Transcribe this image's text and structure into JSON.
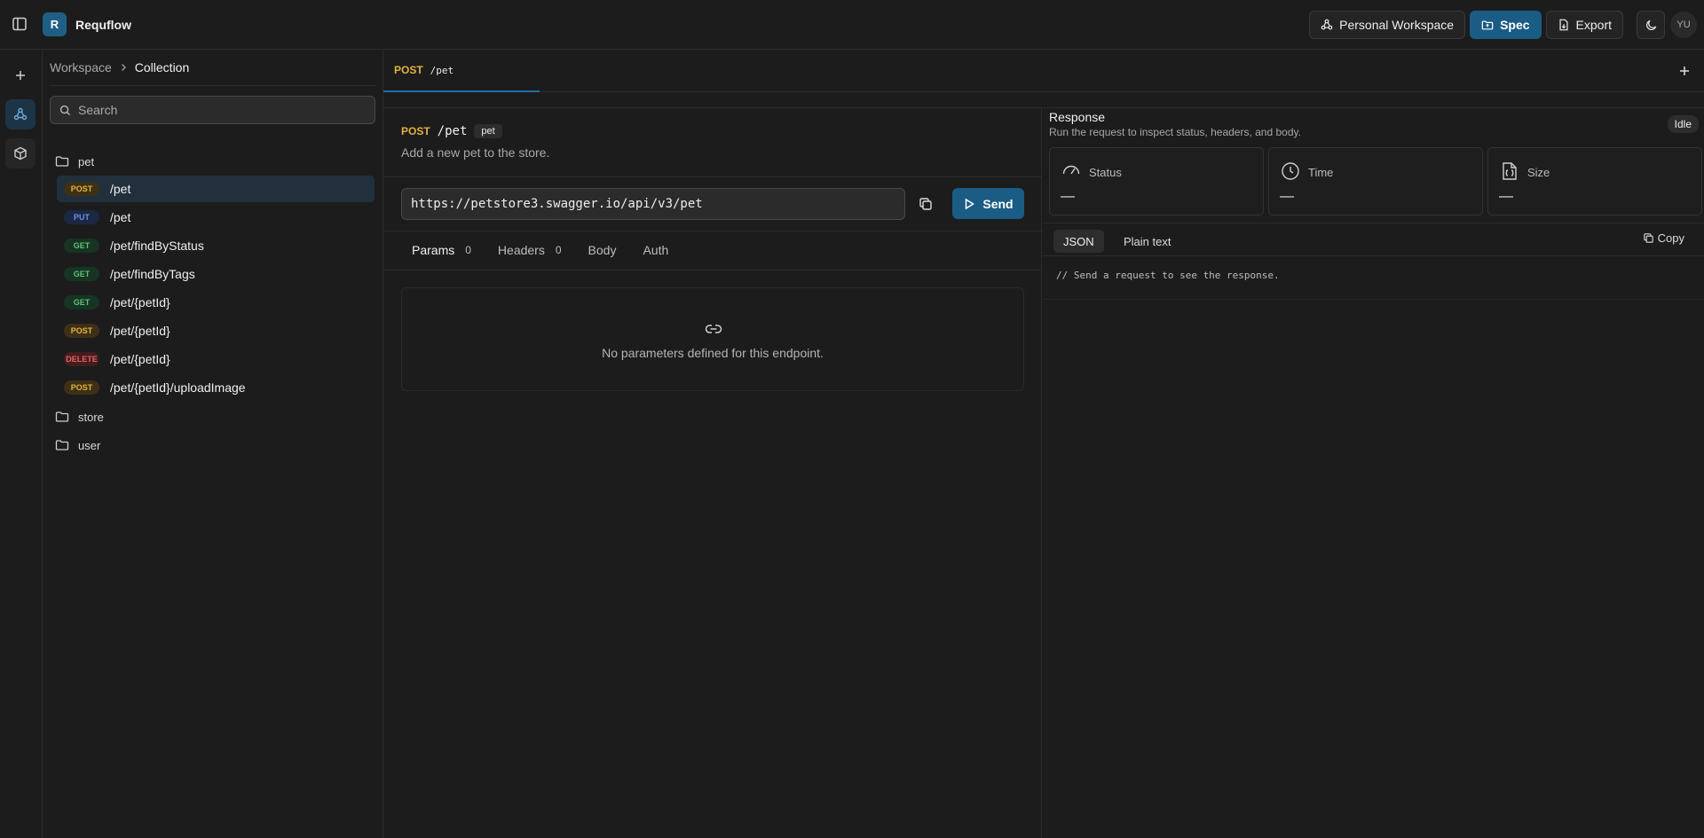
{
  "app": {
    "logo_letter": "R",
    "name": "Requflow"
  },
  "topbar": {
    "workspace_label": "Personal Workspace",
    "spec_label": "Spec",
    "export_label": "Export",
    "avatar_initials": "YU"
  },
  "sidebar": {
    "breadcrumb": [
      "Workspace",
      "Collection"
    ],
    "search_placeholder": "Search",
    "folders": [
      {
        "name": "pet",
        "endpoints": [
          {
            "method": "POST",
            "path": "/pet",
            "active": true
          },
          {
            "method": "PUT",
            "path": "/pet"
          },
          {
            "method": "GET",
            "path": "/pet/findByStatus"
          },
          {
            "method": "GET",
            "path": "/pet/findByTags"
          },
          {
            "method": "GET",
            "path": "/pet/{petId}"
          },
          {
            "method": "POST",
            "path": "/pet/{petId}"
          },
          {
            "method": "DELETE",
            "path": "/pet/{petId}"
          },
          {
            "method": "POST",
            "path": "/pet/{petId}/uploadImage"
          }
        ]
      },
      {
        "name": "store"
      },
      {
        "name": "user"
      }
    ]
  },
  "tab": {
    "method": "POST",
    "path": "/pet"
  },
  "request": {
    "method": "POST",
    "path": "/pet",
    "tag": "pet",
    "description": "Add a new pet to the store.",
    "url": "https://petstore3.swagger.io/api/v3/pet",
    "send_label": "Send",
    "tabs": [
      {
        "label": "Params",
        "count": "0"
      },
      {
        "label": "Headers",
        "count": "0"
      },
      {
        "label": "Body"
      },
      {
        "label": "Auth"
      }
    ],
    "empty_text": "No parameters defined for this endpoint."
  },
  "response": {
    "title": "Response",
    "subtitle": "Run the request to inspect status, headers, and body.",
    "status_badge": "Idle",
    "metrics": [
      {
        "label": "Status",
        "value": "—",
        "icon": "gauge-icon"
      },
      {
        "label": "Time",
        "value": "—",
        "icon": "clock-icon"
      },
      {
        "label": "Size",
        "value": "—",
        "icon": "file-braces-icon"
      }
    ],
    "formats": [
      "JSON",
      "Plain text"
    ],
    "copy_label": "Copy",
    "body_placeholder": "// Send a request to see the response."
  },
  "colors": {
    "accent": "#1b5c85",
    "post": "#e3b341",
    "put": "#6d8fe6",
    "get": "#5cc27c",
    "delete": "#e86161"
  }
}
